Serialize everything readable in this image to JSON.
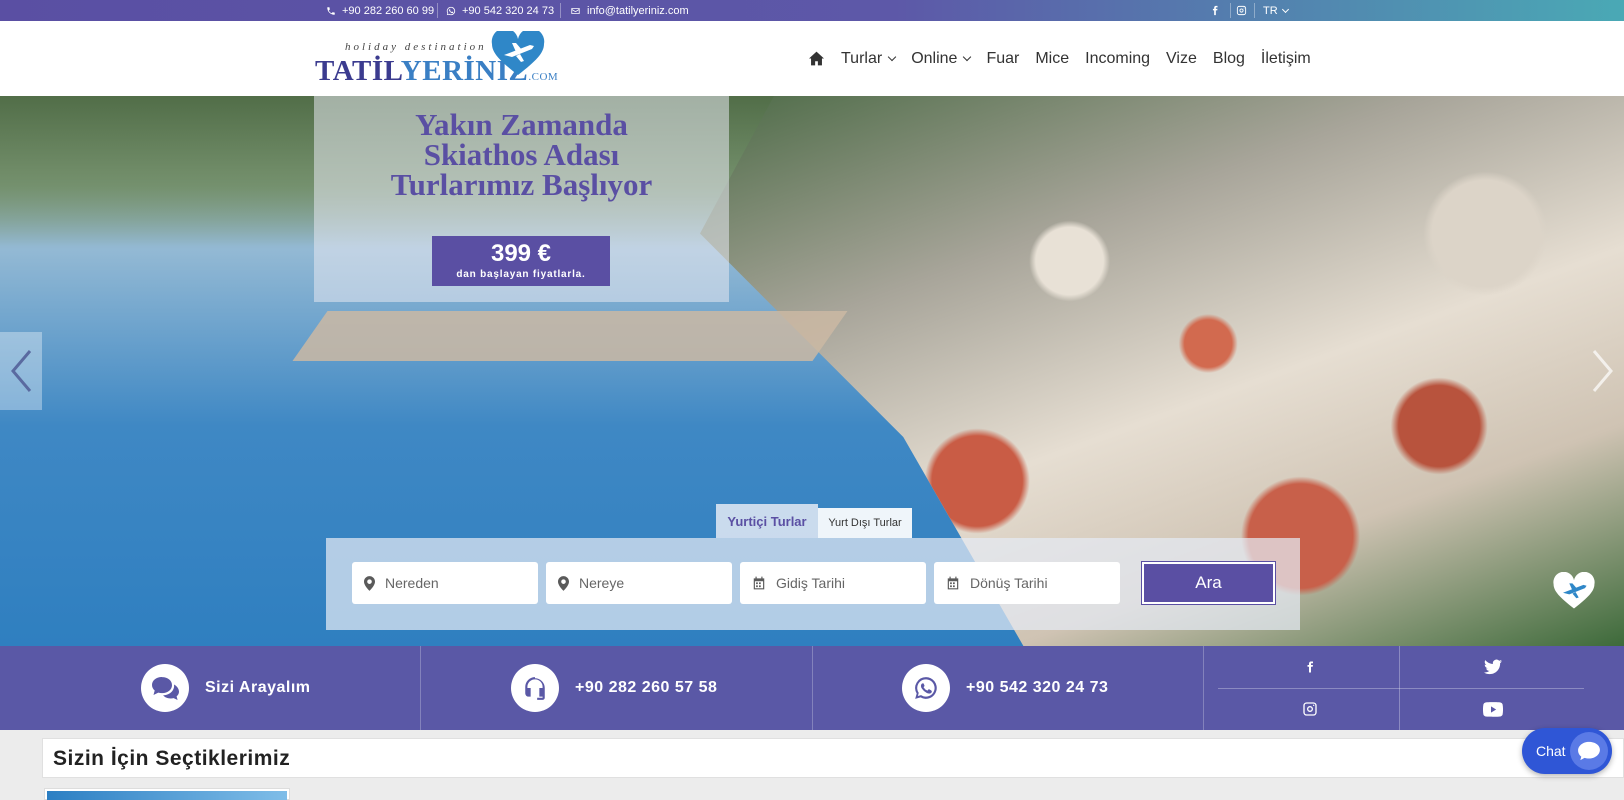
{
  "topbar": {
    "phone": "+90 282 260 60 99",
    "whatsapp": "+90 542 320 24 73",
    "email": "info@tatilyeriniz.com",
    "language": "TR",
    "social_icons": [
      "facebook-icon",
      "instagram-icon"
    ]
  },
  "logo": {
    "tagline": "holiday destination",
    "word_part1": "TATİL",
    "word_part2": "YERİNİZ",
    "suffix": ".COM"
  },
  "nav": {
    "items": [
      {
        "label": "Turlar",
        "dropdown": true
      },
      {
        "label": "Online",
        "dropdown": true
      },
      {
        "label": "Fuar",
        "dropdown": false
      },
      {
        "label": "Mice",
        "dropdown": false
      },
      {
        "label": "Incoming",
        "dropdown": false
      },
      {
        "label": "Vize",
        "dropdown": false
      },
      {
        "label": "Blog",
        "dropdown": false
      },
      {
        "label": "İletişim",
        "dropdown": false
      }
    ]
  },
  "hero": {
    "headline_line1": "Yakın Zamanda",
    "headline_line2": "Skiathos Adası",
    "headline_line3": "Turlarımız Başlıyor",
    "price": "399 €",
    "price_sub": "dan başlayan fiyatlarla."
  },
  "search": {
    "tab_active": "Yurtiçi Turlar",
    "tab_inactive": "Yurt Dışı Turlar",
    "from_placeholder": "Nereden",
    "to_placeholder": "Nereye",
    "depart_placeholder": "Gidiş Tarihi",
    "return_placeholder": "Dönüş Tarihi",
    "button_label": "Ara"
  },
  "infobar": {
    "callback_label": "Sizi Arayalım",
    "phone_label": "+90 282 260 57 58",
    "whatsapp_label": "+90 542 320 24 73"
  },
  "section": {
    "title": "Sizin İçin Seçtiklerimiz"
  },
  "chat": {
    "label": "Chat"
  },
  "colors": {
    "brand": "#5a4fa3",
    "infobar": "#5a58a6",
    "chat": "#2f56d6"
  }
}
